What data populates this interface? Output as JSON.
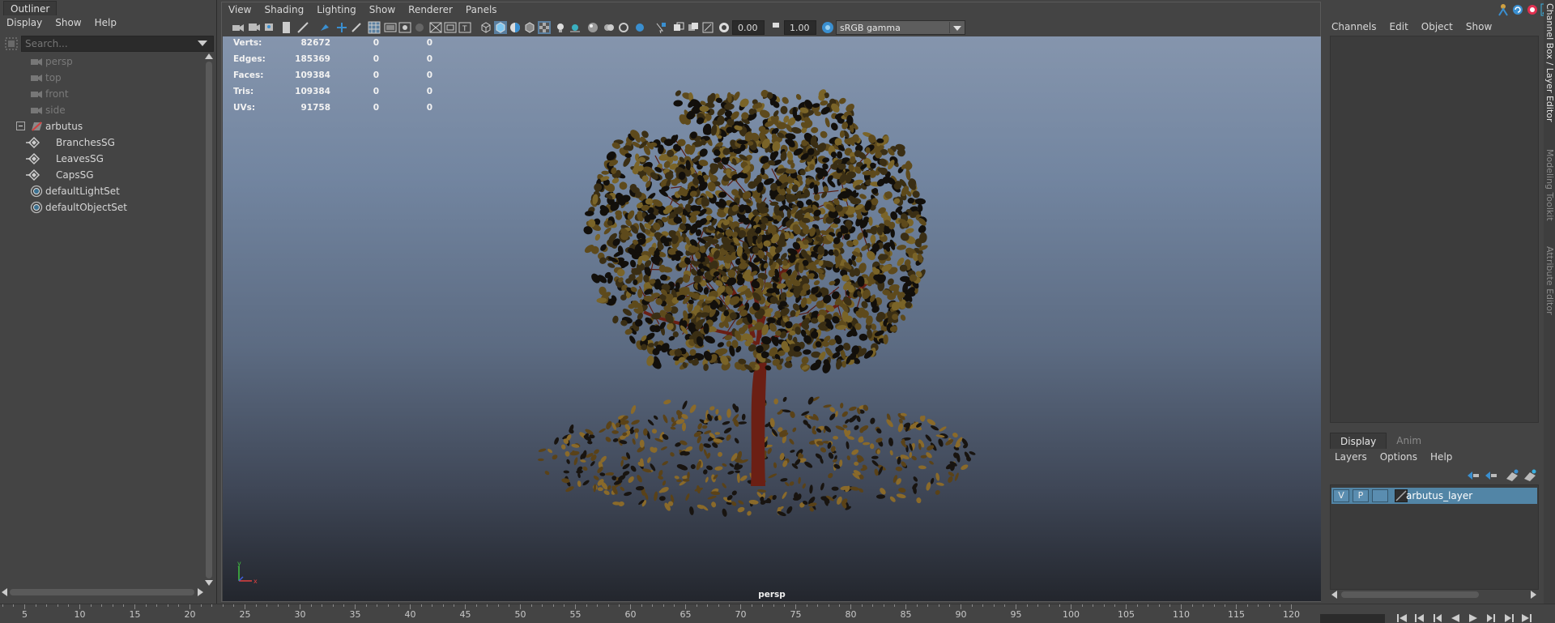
{
  "outliner": {
    "title": "Outliner",
    "menu": [
      "Display",
      "Show",
      "Help"
    ],
    "search_placeholder": "Search...",
    "items": [
      {
        "label": "persp",
        "icon": "camera-icon",
        "state": "dim"
      },
      {
        "label": "top",
        "icon": "camera-icon",
        "state": "dim"
      },
      {
        "label": "front",
        "icon": "camera-icon",
        "state": "dim"
      },
      {
        "label": "side",
        "icon": "camera-icon",
        "state": "dim"
      },
      {
        "label": "arbutus",
        "icon": "transform-group-icon",
        "state": "normal",
        "expanded": true
      },
      {
        "label": "BranchesSG",
        "icon": "shading-group-icon",
        "state": "normal",
        "child": true
      },
      {
        "label": "LeavesSG",
        "icon": "shading-group-icon",
        "state": "normal",
        "child": true
      },
      {
        "label": "CapsSG",
        "icon": "shading-group-icon",
        "state": "normal",
        "child": true
      },
      {
        "label": "defaultLightSet",
        "icon": "object-set-icon",
        "state": "normal"
      },
      {
        "label": "defaultObjectSet",
        "icon": "object-set-icon",
        "state": "normal"
      }
    ]
  },
  "viewport": {
    "menu": [
      "View",
      "Shading",
      "Lighting",
      "Show",
      "Renderer",
      "Panels"
    ],
    "exposure": "0.00",
    "gamma": "1.00",
    "color_space": "sRGB gamma",
    "camera": "persp",
    "hud": [
      {
        "label": "Verts:",
        "v1": "82672",
        "v2": "0",
        "v3": "0"
      },
      {
        "label": "Edges:",
        "v1": "185369",
        "v2": "0",
        "v3": "0"
      },
      {
        "label": "Faces:",
        "v1": "109384",
        "v2": "0",
        "v3": "0"
      },
      {
        "label": "Tris:",
        "v1": "109384",
        "v2": "0",
        "v3": "0"
      },
      {
        "label": "UVs:",
        "v1": "91758",
        "v2": "0",
        "v3": "0"
      }
    ],
    "axis": {
      "x": "x",
      "y": "y"
    }
  },
  "channel_box": {
    "menu": [
      "Channels",
      "Edit",
      "Object",
      "Show"
    ]
  },
  "layer_editor": {
    "tabs": [
      "Display",
      "Anim"
    ],
    "active_tab": "Display",
    "menu": [
      "Layers",
      "Options",
      "Help"
    ],
    "layers": [
      {
        "visible": "V",
        "playback": "P",
        "name": "arbutus_layer"
      }
    ]
  },
  "side_tabs": [
    "Channel Box / Layer Editor",
    "Modeling Toolkit",
    "Attribute Editor"
  ],
  "timeline": {
    "labels": [
      "5",
      "10",
      "15",
      "20",
      "25",
      "30",
      "35",
      "40",
      "45",
      "50",
      "55",
      "60",
      "65",
      "70",
      "75",
      "80",
      "85",
      "90",
      "95",
      "100",
      "105",
      "110",
      "115",
      "120"
    ]
  },
  "colors": {
    "panel_bg": "#444444",
    "selected_layer": "#5285a6",
    "viewport_top": "#8595ad",
    "viewport_bottom": "#23262d",
    "trunk": "#6b1f14",
    "leaf": "#5a4a1a"
  }
}
